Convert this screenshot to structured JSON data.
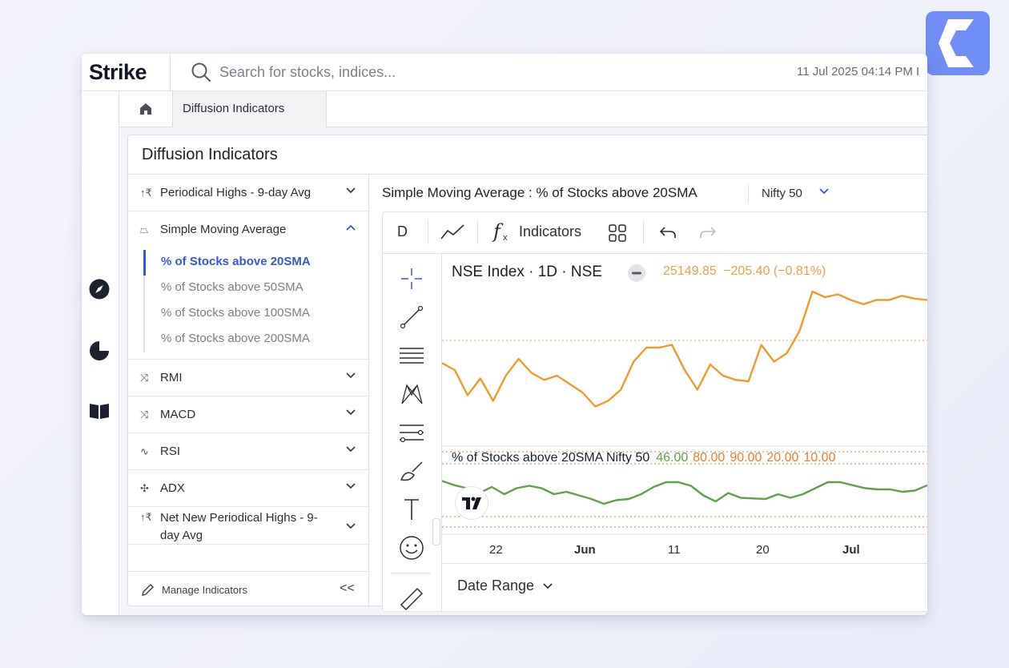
{
  "app": {
    "brand": "Strike"
  },
  "search": {
    "placeholder": "Search for stocks, indices..."
  },
  "datetime": "11 Jul 2025 04:14 PM I",
  "tabs": {
    "active": "Diffusion Indicators"
  },
  "panel": {
    "title": "Diffusion Indicators"
  },
  "sidebar": {
    "groups": [
      {
        "icon": "↑₹",
        "label": "Periodical Highs - 9-day Avg"
      },
      {
        "icon": "⏢",
        "label": "Simple Moving Average"
      },
      {
        "icon": "⤨",
        "label": "RMI"
      },
      {
        "icon": "⤨",
        "label": "MACD"
      },
      {
        "icon": "∿",
        "label": "RSI"
      },
      {
        "icon": "✣",
        "label": "ADX"
      },
      {
        "icon": "↑₹",
        "label": "Net New Periodical Highs - 9-day Avg"
      }
    ],
    "sma_items": [
      "% of Stocks above 20SMA",
      "% of Stocks above 50SMA",
      "% of Stocks above 100SMA",
      "% of Stocks above 200SMA"
    ],
    "manage_label": "Manage Indicators",
    "collapse_label": "<<"
  },
  "main": {
    "title": "Simple Moving Average : % of Stocks above 20SMA",
    "index_select": "Nifty 50"
  },
  "toolbar": {
    "interval": "D",
    "indicators_label": "Indicators",
    "fx_label": "f"
  },
  "chart_legend": {
    "title": "NSE Index · 1D · NSE",
    "last": "25149.85",
    "change": "−205.40 (−0.81%)",
    "sub_title": "% of Stocks above 20SMA Nifty 50",
    "sub_value": "46.00",
    "sub_levels": [
      "80.00",
      "90.00",
      "20.00",
      "10.00"
    ]
  },
  "chart_data": {
    "type": "line",
    "x_ticks": [
      "22",
      "Jun",
      "11",
      "20",
      "Jul"
    ],
    "series": [
      {
        "name": "NSE Index",
        "color": "#ef9a2b",
        "values": [
          45,
          40,
          22,
          34,
          18,
          36,
          48,
          38,
          33,
          36,
          30,
          24,
          14,
          18,
          26,
          46,
          56,
          56,
          58,
          40,
          26,
          44,
          36,
          33,
          32,
          58,
          46,
          52,
          68,
          96,
          92,
          94,
          90,
          87,
          90,
          90,
          93,
          91,
          90
        ]
      },
      {
        "name": "% of Stocks above 20SMA Nifty 50",
        "color": "#5ea04c",
        "values": [
          62,
          55,
          50,
          42,
          52,
          40,
          50,
          54,
          50,
          40,
          44,
          38,
          32,
          24,
          30,
          32,
          40,
          52,
          60,
          60,
          54,
          38,
          28,
          42,
          34,
          33,
          32,
          40,
          34,
          40,
          50,
          60,
          60,
          55,
          50,
          48,
          48,
          44,
          46,
          55
        ]
      }
    ],
    "reference_levels": [
      80,
      90,
      20,
      10
    ]
  },
  "date_range_label": "Date Range"
}
